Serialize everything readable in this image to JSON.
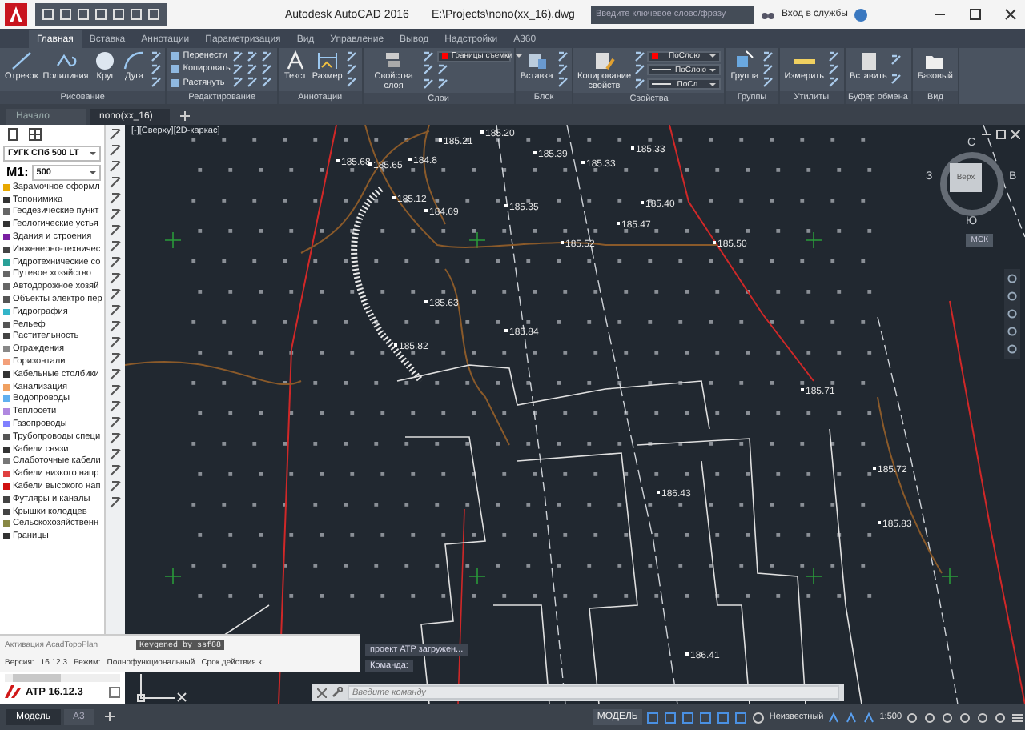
{
  "title_bar": {
    "app_title": "Autodesk AutoCAD 2016",
    "file_path": "E:\\Projects\\nono(xx_16).dwg",
    "search": {
      "placeholder": "Введите ключевое слово/фразу"
    },
    "sign_in": "Вход в службы"
  },
  "ribbon_tabs": [
    {
      "label": "Главная",
      "selected": true
    },
    {
      "label": "Вставка",
      "selected": false
    },
    {
      "label": "Аннотации",
      "selected": false
    },
    {
      "label": "Параметризация",
      "selected": false
    },
    {
      "label": "Вид",
      "selected": false
    },
    {
      "label": "Управление",
      "selected": false
    },
    {
      "label": "Вывод",
      "selected": false
    },
    {
      "label": "Надстройки",
      "selected": false
    },
    {
      "label": "A360",
      "selected": false
    }
  ],
  "ribbon_panels": [
    {
      "title": "Рисование",
      "tools": [
        {
          "kind": "large",
          "label": "Отрезок"
        },
        {
          "kind": "large",
          "label": "Полилиния"
        },
        {
          "kind": "large",
          "label": "Круг"
        },
        {
          "kind": "large",
          "label": "Дуга"
        },
        {
          "kind": "icon"
        },
        {
          "kind": "icon"
        },
        {
          "kind": "icon"
        }
      ]
    },
    {
      "title": "Редактирование",
      "tools": [
        {
          "kind": "small",
          "label": "Перенести"
        },
        {
          "kind": "small",
          "label": "Копировать"
        },
        {
          "kind": "small",
          "label": "Растянуть"
        },
        {
          "kind": "icon"
        },
        {
          "kind": "icon"
        },
        {
          "kind": "icon"
        },
        {
          "kind": "icon"
        },
        {
          "kind": "icon"
        },
        {
          "kind": "icon"
        },
        {
          "kind": "icon"
        },
        {
          "kind": "icon"
        },
        {
          "kind": "icon"
        }
      ]
    },
    {
      "title": "Аннотации",
      "tools": [
        {
          "kind": "large",
          "label": "Текст"
        },
        {
          "kind": "large",
          "label": "Размер"
        },
        {
          "kind": "icon"
        },
        {
          "kind": "icon"
        },
        {
          "kind": "icon"
        }
      ]
    },
    {
      "title": "Слои",
      "tools": [
        {
          "kind": "large",
          "label": "Свойства слоя"
        },
        {
          "kind": "icon"
        },
        {
          "kind": "icon"
        },
        {
          "kind": "icon"
        },
        {
          "kind": "dropdown",
          "label": "Границы съемки",
          "color": "#ff0000"
        },
        {
          "kind": "icon"
        },
        {
          "kind": "icon"
        }
      ]
    },
    {
      "title": "Блок",
      "tools": [
        {
          "kind": "large",
          "label": "Вставка"
        },
        {
          "kind": "icon"
        },
        {
          "kind": "icon"
        },
        {
          "kind": "icon"
        }
      ]
    },
    {
      "title": "Свойства",
      "tools": [
        {
          "kind": "large",
          "label": "Копирование свойств"
        },
        {
          "kind": "icon"
        },
        {
          "kind": "icon"
        },
        {
          "kind": "icon"
        },
        {
          "kind": "dropdown",
          "label": "ПоСлою",
          "color": "#ff0000"
        },
        {
          "kind": "linetype",
          "label": "ПоСлою"
        },
        {
          "kind": "linetype",
          "label": "ПоСл..."
        }
      ]
    },
    {
      "title": "Группы",
      "tools": [
        {
          "kind": "large",
          "label": "Группа"
        },
        {
          "kind": "icon"
        },
        {
          "kind": "icon"
        },
        {
          "kind": "icon"
        }
      ]
    },
    {
      "title": "Утилиты",
      "tools": [
        {
          "kind": "large",
          "label": "Измерить"
        },
        {
          "kind": "icon"
        },
        {
          "kind": "icon"
        },
        {
          "kind": "icon"
        }
      ]
    },
    {
      "title": "Буфер обмена",
      "tools": [
        {
          "kind": "large",
          "label": "Вставить"
        },
        {
          "kind": "icon"
        },
        {
          "kind": "icon"
        }
      ]
    },
    {
      "title": "Вид",
      "tools": [
        {
          "kind": "large",
          "label": "Базовый"
        }
      ]
    }
  ],
  "document_tabs": [
    {
      "label": "Начало",
      "selected": false
    },
    {
      "label": "nono(xx_16)",
      "selected": true
    }
  ],
  "palette": {
    "standard": "ГУГК СПб 500 LT",
    "scale_label": "М1:",
    "scale": "500",
    "layers": [
      {
        "name": "Зарамочное оформл",
        "color": "#e8a800"
      },
      {
        "name": "Топонимика",
        "color": "#333333"
      },
      {
        "name": "Геодезические пункт",
        "color": "#666666"
      },
      {
        "name": "Геологические устья",
        "color": "#333333"
      },
      {
        "name": "Здания и строения",
        "color": "#7a1fa2"
      },
      {
        "name": "Инженерно-техничес",
        "color": "#444444"
      },
      {
        "name": "Гидротехнические со",
        "color": "#2aa198"
      },
      {
        "name": "Путевое хозяйство",
        "color": "#666666"
      },
      {
        "name": "Автодорожное хозяй",
        "color": "#666666"
      },
      {
        "name": "Объекты электро пер",
        "color": "#555555"
      },
      {
        "name": "Гидрография",
        "color": "#33b5c9"
      },
      {
        "name": "Рельеф",
        "color": "#555555"
      },
      {
        "name": "Растительность",
        "color": "#444444"
      },
      {
        "name": "Ограждения",
        "color": "#888888"
      },
      {
        "name": "Горизонтали",
        "color": "#f3a07a"
      },
      {
        "name": "Кабельные столбики",
        "color": "#333333"
      },
      {
        "name": "Канализация",
        "color": "#f0a060"
      },
      {
        "name": "Водопроводы",
        "color": "#60b0f0"
      },
      {
        "name": "Теплосети",
        "color": "#b088e0"
      },
      {
        "name": "Газопроводы",
        "color": "#8080ff"
      },
      {
        "name": "Трубопроводы специ",
        "color": "#555555"
      },
      {
        "name": "Кабели связи",
        "color": "#333333"
      },
      {
        "name": "Слаботочные кабели",
        "color": "#777777"
      },
      {
        "name": "Кабели низкого напр",
        "color": "#e04040"
      },
      {
        "name": "Кабели высокого нап",
        "color": "#d01010"
      },
      {
        "name": "Футляры и каналы",
        "color": "#444444"
      },
      {
        "name": "Крышки колодцев",
        "color": "#444444"
      },
      {
        "name": "Сельскохозяйственн",
        "color": "#888844"
      },
      {
        "name": "Границы",
        "color": "#333333"
      }
    ]
  },
  "activation": {
    "title": "Активация AcadTopoPlan",
    "key_note": "Keygened by ssf88",
    "version_label": "Версия:",
    "version": "16.12.3",
    "mode_label": "Режим:",
    "mode": "Полнофункциональный",
    "expiry_label": "Срок действия к"
  },
  "palette_footer": {
    "product": "ATP 16.12.3"
  },
  "viewport": {
    "label": "[-][Сверху][2D-каркас]",
    "elevations": [
      "185.21",
      "185.20",
      "185.68",
      "185.65",
      "184.8",
      "185.39",
      "185.33",
      "185.33",
      "185.12",
      "184.69",
      "185.35",
      "185.40",
      "185.47",
      "185.52",
      "185.50",
      "185.63",
      "185.82",
      "185.84",
      "185.71",
      "185.72",
      "185.83",
      "186.43",
      "186.41"
    ],
    "view_cube": {
      "top": "Верх",
      "north": "С",
      "east": "В",
      "south": "Ю",
      "west": "З",
      "ucs": "МСК"
    }
  },
  "command_line": {
    "history": [
      "проект ATP загружен...",
      "Команда:"
    ],
    "placeholder": "Введите команду"
  },
  "layout_tabs": [
    {
      "label": "Модель",
      "selected": true
    },
    {
      "label": "A3",
      "selected": false
    }
  ],
  "status_bar": {
    "space": "МОДЕЛЬ",
    "coordinate_system": "Неизвестный",
    "scale": "1:500"
  }
}
